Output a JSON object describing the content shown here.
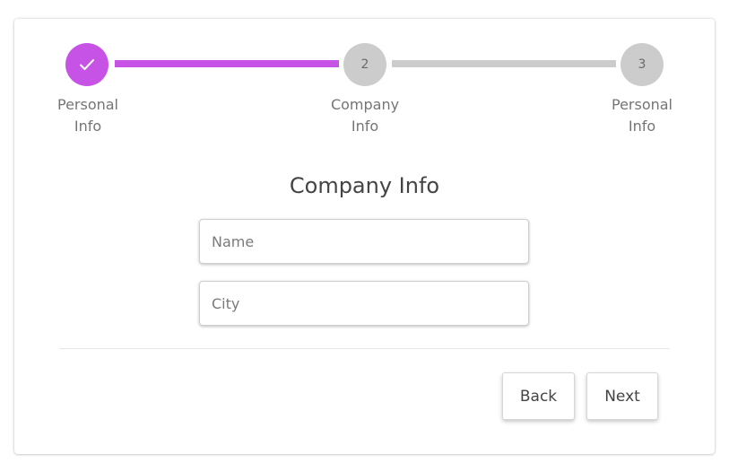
{
  "colors": {
    "accent": "#c653e6",
    "pending": "#cccccc"
  },
  "stepper": {
    "steps": [
      {
        "number": "1",
        "label": "Personal\nInfo",
        "status": "complete",
        "icon": "check-icon"
      },
      {
        "number": "2",
        "label": "Company\nInfo",
        "status": "pending"
      },
      {
        "number": "3",
        "label": "Personal\nInfo",
        "status": "pending"
      }
    ],
    "connectors": [
      {
        "status": "complete"
      },
      {
        "status": "pending"
      }
    ]
  },
  "form": {
    "title": "Company Info",
    "fields": [
      {
        "placeholder": "Name",
        "value": ""
      },
      {
        "placeholder": "City",
        "value": ""
      }
    ]
  },
  "actions": {
    "back_label": "Back",
    "next_label": "Next"
  }
}
